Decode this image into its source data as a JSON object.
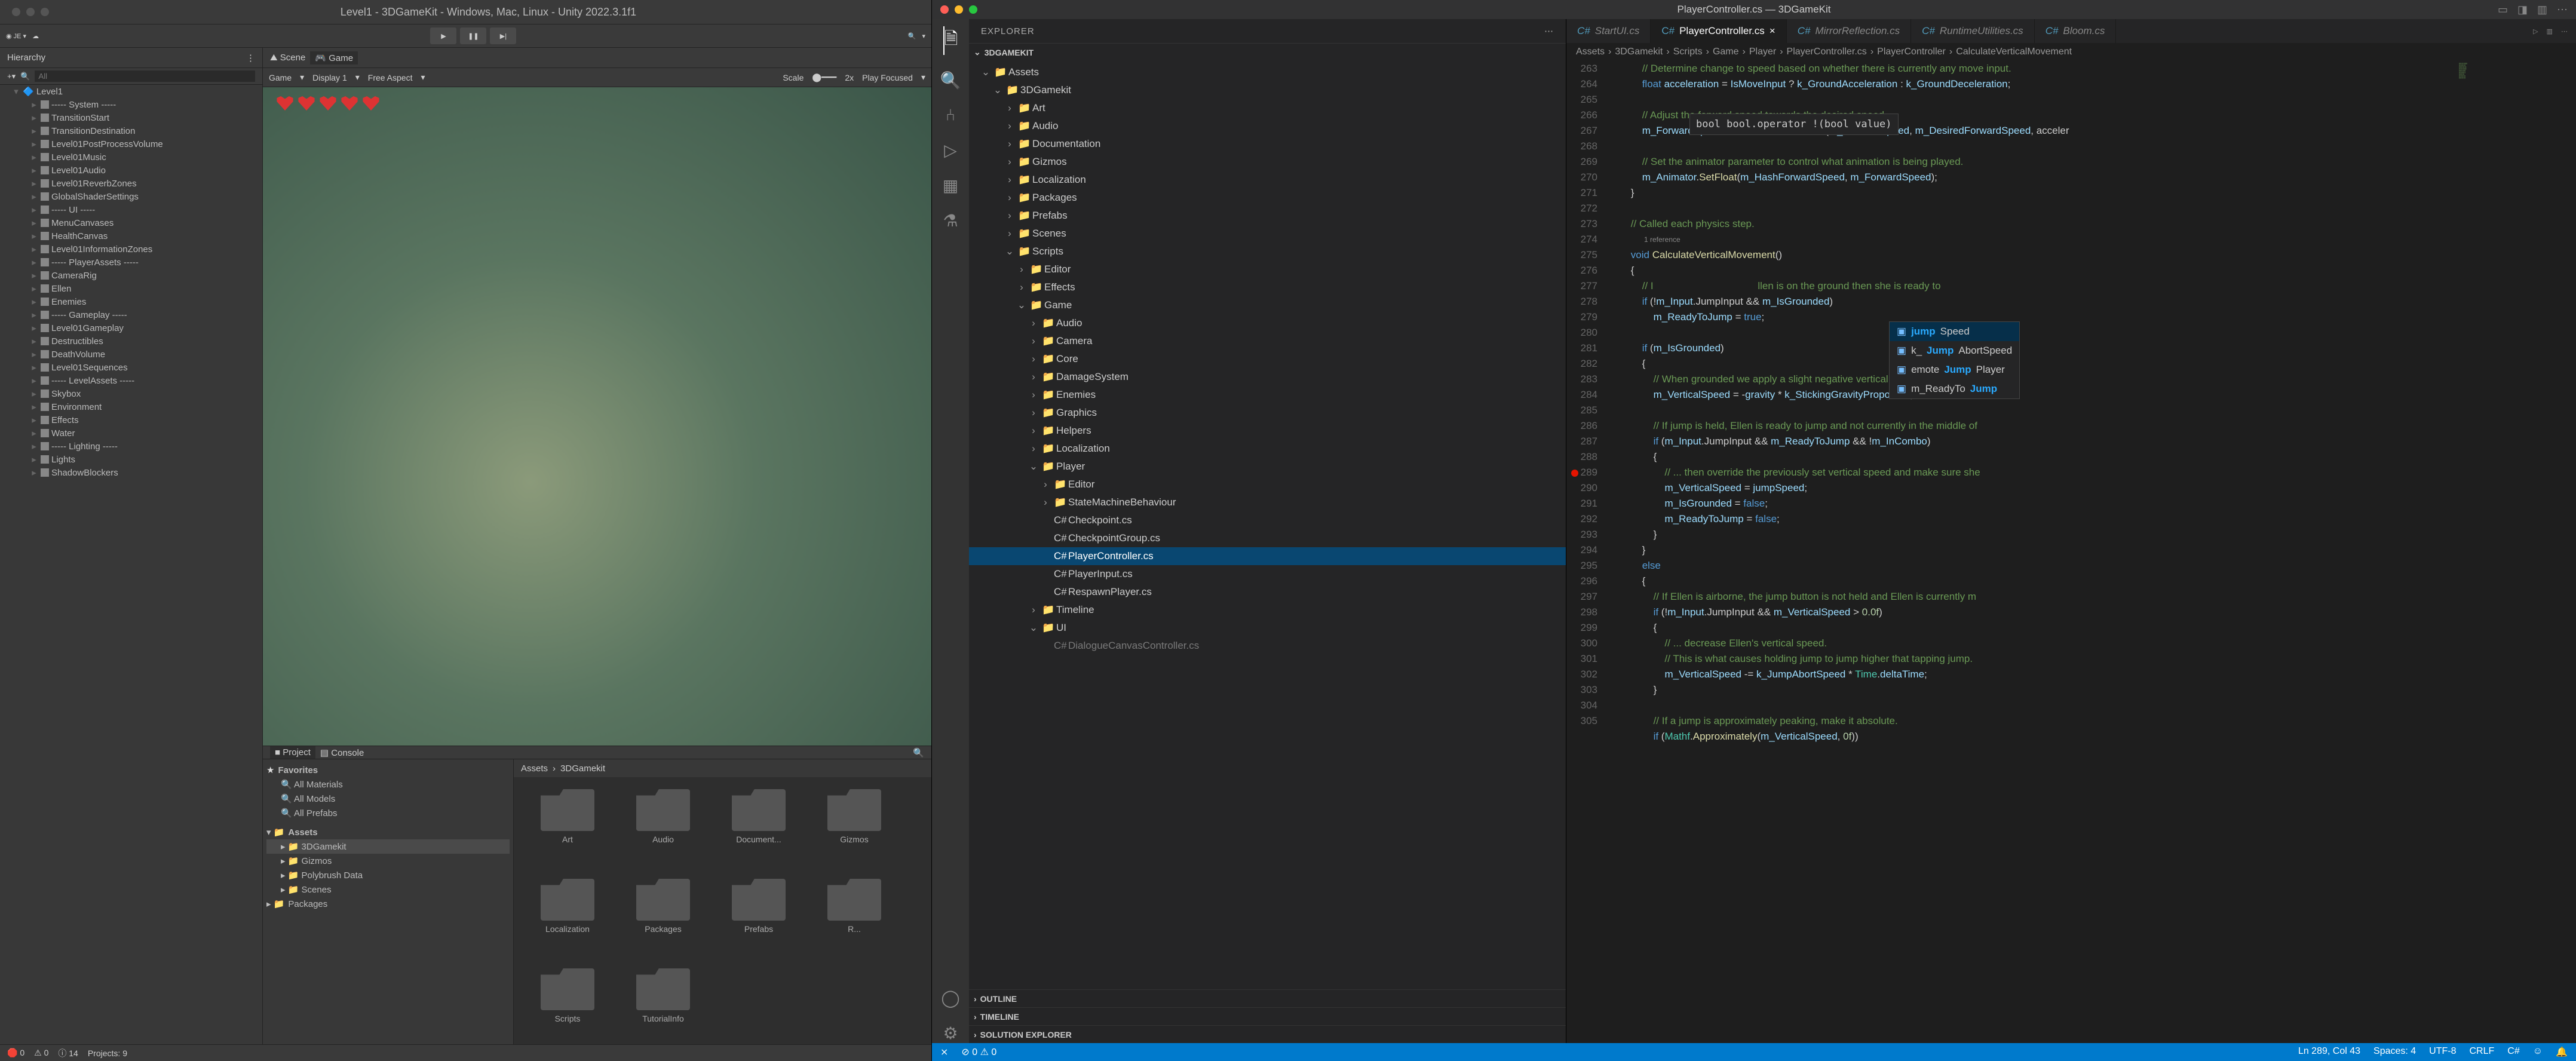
{
  "unity": {
    "title": "Level1 - 3DGameKit - Windows, Mac, Linux - Unity 2022.3.1f1",
    "account": "JE",
    "hierarchy_label": "Hierarchy",
    "search_placeholder": "All",
    "root": "Level1",
    "items": [
      "----- System -----",
      "TransitionStart",
      "TransitionDestination",
      "Level01PostProcessVolume",
      "Level01Music",
      "Level01Audio",
      "Level01ReverbZones",
      "GlobalShaderSettings",
      "----- UI -----",
      "MenuCanvases",
      "HealthCanvas",
      "Level01InformationZones",
      "----- PlayerAssets -----",
      "CameraRig",
      "Ellen",
      "Enemies",
      "----- Gameplay -----",
      "Level01Gameplay",
      "Destructibles",
      "DeathVolume",
      "Level01Sequences",
      "----- LevelAssets -----",
      "Skybox",
      "Environment",
      "Effects",
      "Water",
      "----- Lighting -----",
      "Lights",
      "ShadowBlockers"
    ],
    "scene_tab": "Scene",
    "game_tab": "Game",
    "game_bar": {
      "dd": "Game",
      "display": "Display 1",
      "aspect": "Free Aspect",
      "scale": "Scale",
      "mult": "2x",
      "play": "Play Focused"
    },
    "project_tab": "Project",
    "console_tab": "Console",
    "breadcrumb": [
      "Assets",
      "3DGamekit"
    ],
    "favorites": "Favorites",
    "fav_items": [
      "All Materials",
      "All Models",
      "All Prefabs"
    ],
    "assets": "Assets",
    "asset_tree": [
      "3DGamekit",
      "Gizmos",
      "Polybrush Data",
      "Scenes"
    ],
    "packages": "Packages",
    "folders": [
      "Art",
      "Audio",
      "Document...",
      "Gizmos",
      "Localization",
      "Packages",
      "Prefabs",
      "R...",
      "Scripts",
      "TutorialInfo"
    ],
    "status": {
      "err": "0",
      "warn": "0",
      "info": "14",
      "proj": "Projects: 9"
    }
  },
  "vscode": {
    "title": "PlayerController.cs — 3DGameKit",
    "explorer": "EXPLORER",
    "root": "3DGAMEKIT",
    "tree": [
      {
        "l": "Assets",
        "d": 1,
        "o": true
      },
      {
        "l": "3DGamekit",
        "d": 2,
        "o": true
      },
      {
        "l": "Art",
        "d": 3
      },
      {
        "l": "Audio",
        "d": 3
      },
      {
        "l": "Documentation",
        "d": 3
      },
      {
        "l": "Gizmos",
        "d": 3
      },
      {
        "l": "Localization",
        "d": 3
      },
      {
        "l": "Packages",
        "d": 3
      },
      {
        "l": "Prefabs",
        "d": 3
      },
      {
        "l": "Scenes",
        "d": 3
      },
      {
        "l": "Scripts",
        "d": 3,
        "o": true
      },
      {
        "l": "Editor",
        "d": 4
      },
      {
        "l": "Effects",
        "d": 4
      },
      {
        "l": "Game",
        "d": 4,
        "o": true
      },
      {
        "l": "Audio",
        "d": 5
      },
      {
        "l": "Camera",
        "d": 5
      },
      {
        "l": "Core",
        "d": 5
      },
      {
        "l": "DamageSystem",
        "d": 5
      },
      {
        "l": "Enemies",
        "d": 5
      },
      {
        "l": "Graphics",
        "d": 5
      },
      {
        "l": "Helpers",
        "d": 5
      },
      {
        "l": "Localization",
        "d": 5
      },
      {
        "l": "Player",
        "d": 5,
        "o": true
      },
      {
        "l": "Editor",
        "d": 6
      },
      {
        "l": "StateMachineBehaviour",
        "d": 6
      },
      {
        "l": "Checkpoint.cs",
        "d": 6,
        "f": true
      },
      {
        "l": "CheckpointGroup.cs",
        "d": 6,
        "f": true
      },
      {
        "l": "PlayerController.cs",
        "d": 6,
        "f": true,
        "sel": true
      },
      {
        "l": "PlayerInput.cs",
        "d": 6,
        "f": true
      },
      {
        "l": "RespawnPlayer.cs",
        "d": 6,
        "f": true
      },
      {
        "l": "Timeline",
        "d": 5
      },
      {
        "l": "UI",
        "d": 5,
        "o": true
      },
      {
        "l": "DialogueCanvasController.cs",
        "d": 6,
        "f": true,
        "cut": true
      }
    ],
    "outline": "OUTLINE",
    "timeline": "TIMELINE",
    "solution": "SOLUTION EXPLORER",
    "tabs": [
      {
        "l": "StartUI.cs"
      },
      {
        "l": "PlayerController.cs",
        "on": true,
        "close": true
      },
      {
        "l": "MirrorReflection.cs"
      },
      {
        "l": "RuntimeUtilities.cs"
      },
      {
        "l": "Bloom.cs"
      }
    ],
    "crumbs": [
      "Assets",
      "3DGamekit",
      "Scripts",
      "Game",
      "Player",
      "PlayerController.cs",
      "PlayerController",
      "CalculateVerticalMovement"
    ],
    "code": {
      "start": 263,
      "lines": [
        "            // Determine change to speed based on whether there is currently any move input.",
        "            float acceleration = IsMoveInput ? k_GroundAcceleration : k_GroundDeceleration;",
        "",
        "            // Adjust the forward speed towards the desired speed.",
        "            m_ForwardSpeed = Mathf.MoveTowards(m_ForwardSpeed, m_DesiredForwardSpeed, acceler",
        "",
        "            // Set the animator parameter to control what animation is being played.",
        "            m_Animator.SetFloat(m_HashForwardSpeed, m_ForwardSpeed);",
        "        }",
        "",
        "        // Called each physics step.",
        "        void CalculateVerticalMovement()",
        "        {",
        "            // I                                     llen is on the ground then she is ready to",
        "            if (!m_Input.JumpInput && m_IsGrounded)",
        "                m_ReadyToJump = true;",
        "",
        "            if (m_IsGrounded)",
        "            {",
        "                // When grounded we apply a slight negative vertical speed to make Ellen \"sti",
        "                m_VerticalSpeed = -gravity * k_StickingGravityProportion;",
        "",
        "                // If jump is held, Ellen is ready to jump and not currently in the middle of",
        "                if (m_Input.JumpInput && m_ReadyToJump && !m_InCombo)",
        "                {",
        "                    // ... then override the previously set vertical speed and make sure she",
        "                    m_VerticalSpeed = jumpSpeed;",
        "                    m_IsGrounded = false;",
        "                    m_ReadyToJump = false;",
        "                }",
        "            }",
        "            else",
        "            {",
        "                // If Ellen is airborne, the jump button is not held and Ellen is currently m",
        "                if (!m_Input.JumpInput && m_VerticalSpeed > 0.0f)",
        "                {",
        "                    // ... decrease Ellen's vertical speed.",
        "                    // This is what causes holding jump to jump higher that tapping jump.",
        "                    m_VerticalSpeed -= k_JumpAbortSpeed * Time.deltaTime;",
        "                }",
        "",
        "                // If a jump is approximately peaking, make it absolute.",
        "                if (Mathf.Approximately(m_VerticalSpeed, 0f))"
      ],
      "ref": "1 reference",
      "hover": "bool bool.operator !(bool value)",
      "suggest": [
        "jumpSpeed",
        "k_JumpAbortSpeed",
        "emoteJumpPlayer",
        "m_ReadyToJump"
      ]
    },
    "status": {
      "errors": "0",
      "warnings": "0",
      "pos": "Ln 289, Col 43",
      "spaces": "Spaces: 4",
      "enc": "UTF-8",
      "eol": "CRLF",
      "lang": "C#"
    }
  }
}
